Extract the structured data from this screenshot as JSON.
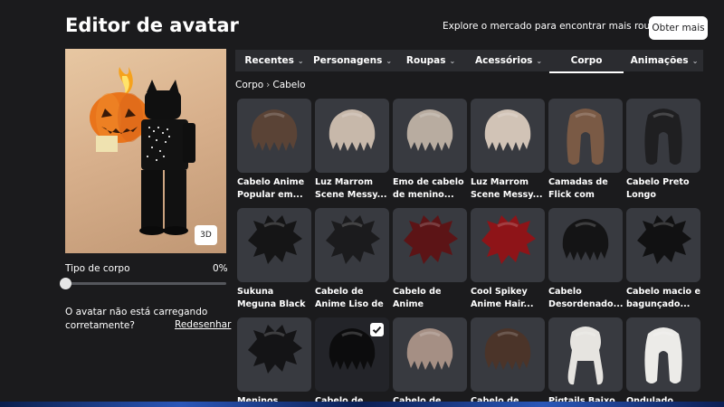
{
  "header": {
    "title": "Editor de avatar",
    "promo_text": "Explore o mercado para encontrar mais roupas!",
    "more_button": "Obter mais"
  },
  "preview": {
    "view_3d_label": "3D",
    "body_type_label": "Tipo de corpo",
    "body_type_value": "0%",
    "body_type_level": 0,
    "loading_message": "O avatar não está carregando corretamente?",
    "redraw_link": "Redesenhar"
  },
  "tabs": [
    {
      "label": "Recentes",
      "active": false
    },
    {
      "label": "Personagens",
      "active": false
    },
    {
      "label": "Roupas",
      "active": false
    },
    {
      "label": "Acessórios",
      "active": false
    },
    {
      "label": "Corpo",
      "active": true
    },
    {
      "label": "Animações",
      "active": false
    }
  ],
  "breadcrumb": {
    "parent": "Corpo",
    "current": "Cabelo"
  },
  "items": [
    {
      "name": "Cabelo Anime Popular em...",
      "hair_color": "#5a4336",
      "style": "short",
      "selected": false
    },
    {
      "name": "Luz Marrom Scene Messy...",
      "hair_color": "#c7b8aa",
      "style": "short",
      "selected": false
    },
    {
      "name": "Emo de cabelo de menino...",
      "hair_color": "#b8aca0",
      "style": "short",
      "selected": false
    },
    {
      "name": "Luz Marrom Scene Messy...",
      "hair_color": "#d1c3b6",
      "style": "short",
      "selected": false
    },
    {
      "name": "Camadas de Flick com Pena...",
      "hair_color": "#7a5a45",
      "style": "long",
      "selected": false
    },
    {
      "name": "Cabelo Preto Longo Adorável",
      "hair_color": "#1f1f21",
      "style": "long",
      "selected": false
    },
    {
      "name": "Sukuna Meguna Black Spikey...",
      "hair_color": "#151516",
      "style": "spiky",
      "selected": false
    },
    {
      "name": "Cabelo de Anime Liso de Costas...",
      "hair_color": "#1b1b1d",
      "style": "spiky",
      "selected": false
    },
    {
      "name": "Cabelo de Anime Desordenado...",
      "hair_color": "#5c1416",
      "style": "spiky",
      "selected": false
    },
    {
      "name": "Cool Spikey Anime Hair...",
      "hair_color": "#8e1418",
      "style": "spiky",
      "selected": false
    },
    {
      "name": "Cabelo Desordenado...",
      "hair_color": "#141415",
      "style": "short",
      "selected": false
    },
    {
      "name": "Cabelo macio e bagunçado...",
      "hair_color": "#111112",
      "style": "spiky",
      "selected": false
    },
    {
      "name": "Meninos Anime...",
      "hair_color": "#141416",
      "style": "spiky",
      "selected": false
    },
    {
      "name": "Cabelo de cena...",
      "hair_color": "#0c0c0d",
      "style": "short",
      "selected": true
    },
    {
      "name": "Cabelo de cena...",
      "hair_color": "#a58f84",
      "style": "short",
      "selected": false
    },
    {
      "name": "Cabelo de Anime...",
      "hair_color": "#4b3429",
      "style": "short",
      "selected": false
    },
    {
      "name": "Pigtails Baixo W...",
      "hair_color": "#e6e4e0",
      "style": "pigtails",
      "selected": false
    },
    {
      "name": "Ondulado reto...",
      "hair_color": "#ecebe8",
      "style": "long",
      "selected": false
    }
  ],
  "colors": {
    "background": "#1b1b1d",
    "card": "#383a40",
    "tabbar": "#2b2c30",
    "text": "#ffffff"
  }
}
